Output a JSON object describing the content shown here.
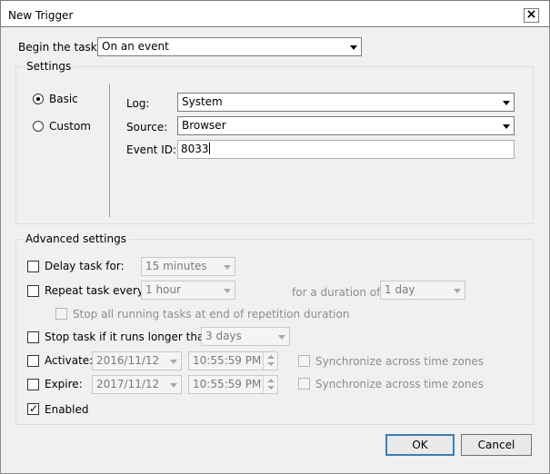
{
  "window": {
    "title": "New Trigger",
    "close_glyph": "×"
  },
  "begin": {
    "label": "Begin the task:",
    "value": "On an event"
  },
  "settings": {
    "title": "Settings",
    "basic_label": "Basic",
    "custom_label": "Custom",
    "selected": "Basic",
    "log_label": "Log:",
    "log_value": "System",
    "source_label": "Source:",
    "source_value": "Browser",
    "event_id_label": "Event ID:",
    "event_id_value": "8033"
  },
  "advanced": {
    "title": "Advanced settings",
    "delay_label": "Delay task for:",
    "delay_checked": false,
    "delay_value": "15 minutes",
    "repeat_label": "Repeat task every:",
    "repeat_checked": false,
    "repeat_value": "1 hour",
    "duration_label": "for a duration of:",
    "duration_value": "1 day",
    "stop_all_label": "Stop all running tasks at end of repetition duration",
    "stop_all_checked": false,
    "stop_longer_label": "Stop task if it runs longer than:",
    "stop_longer_checked": false,
    "stop_longer_value": "3 days",
    "activate_label": "Activate:",
    "activate_checked": false,
    "activate_date": "2016/11/12",
    "activate_time": "10:55:59 PM",
    "activate_sync_label": "Synchronize across time zones",
    "expire_label": "Expire:",
    "expire_checked": false,
    "expire_date": "2017/11/12",
    "expire_time": "10:55:59 PM",
    "expire_sync_label": "Synchronize across time zones",
    "enabled_label": "Enabled",
    "enabled_checked": true
  },
  "buttons": {
    "ok_label": "OK",
    "cancel_label": "Cancel"
  },
  "colors": {
    "group_border": "#d5dfe5",
    "dialog_bg": "#f0f0f0",
    "default_button_border": "#3c7fb1"
  }
}
